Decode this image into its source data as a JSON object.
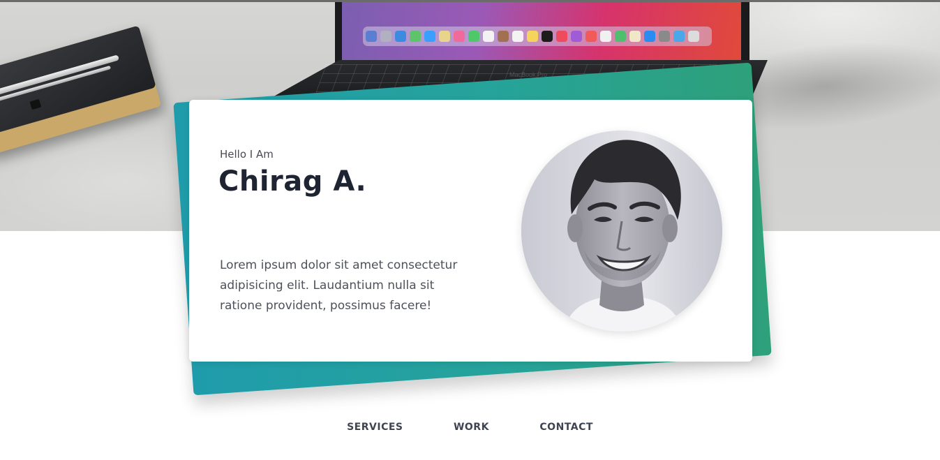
{
  "hero": {
    "laptop_brand": "MacBook Pro"
  },
  "card": {
    "greeting": "Hello I Am",
    "name": "Chirag A.",
    "bio": "Lorem ipsum dolor sit amet consectetur adipisicing elit. Laudantium nulla sit ratione provident, possimus facere!"
  },
  "nav": {
    "items": [
      {
        "label": "SERVICES"
      },
      {
        "label": "WORK"
      },
      {
        "label": "CONTACT"
      }
    ]
  },
  "colors": {
    "accent_teal": "#1f9cab",
    "accent_green": "#2ea07a",
    "heading": "#1f2433",
    "body_text": "#4d5159",
    "nav_text": "#3f4452"
  },
  "icons": [
    "profile-photo"
  ]
}
